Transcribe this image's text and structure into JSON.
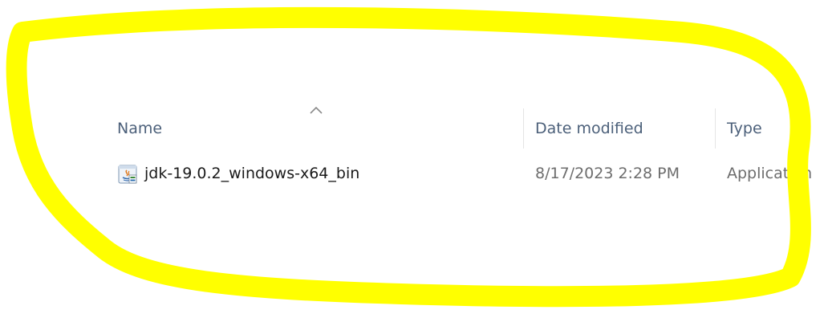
{
  "columns": {
    "name": "Name",
    "date_modified": "Date modified",
    "type": "Type"
  },
  "sort": {
    "column": "name",
    "direction": "ascending",
    "icon": "chevron-up-icon"
  },
  "files": [
    {
      "name": "jdk-19.0.2_windows-x64_bin",
      "date_modified": "8/17/2023 2:28 PM",
      "type": "Application",
      "icon": "java-installer-icon"
    }
  ],
  "colors": {
    "highlight": "#ffff00",
    "header_text": "#4c607a",
    "secondary_text": "#6d6d6d",
    "primary_text": "#1a1a1a"
  }
}
